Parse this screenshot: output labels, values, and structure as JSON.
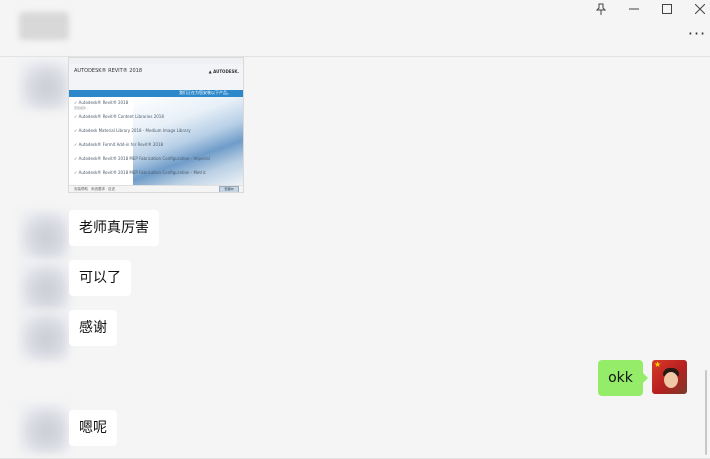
{
  "titlebar": {
    "icons": {
      "pin": "pin-icon",
      "minimize": "minimize-icon",
      "maximize": "maximize-icon",
      "close": "close-icon",
      "more": "more-icon"
    },
    "more_label": "···"
  },
  "image_message": {
    "brand": "AUTODESK® REVIT® 2018",
    "logo": "▲ AUTODESK.",
    "bar_text": "我们正在为您安装以下产品。",
    "rows": [
      {
        "title": "✓ Autodesk® Revit® 2018",
        "sub": "安装组件..."
      },
      {
        "title": "✓ Autodesk® Revit® Content Libraries 2018",
        "sub": ""
      },
      {
        "title": "✓ Autodesk Material Library 2018 - Medium Image Library",
        "sub": ""
      },
      {
        "title": "✓ Autodesk® Formit Add-in for Revit® 2018",
        "sub": ""
      },
      {
        "title": "✓ Autodesk® Revit® 2018 MEP Fabrication Configuration - Imperial",
        "sub": ""
      },
      {
        "title": "✓ Autodesk® Revit® 2018 MEP Fabrication Configuration - Metric",
        "sub": ""
      }
    ],
    "footer": [
      "安装帮助",
      "系统要求",
      "自述"
    ],
    "install_button": "安装中"
  },
  "messages": [
    {
      "sender": "other",
      "text": "老师真厉害"
    },
    {
      "sender": "other",
      "text": "可以了"
    },
    {
      "sender": "other",
      "text": "感谢"
    },
    {
      "sender": "self",
      "text": "okk"
    },
    {
      "sender": "other",
      "text": "嗯呢"
    }
  ],
  "colors": {
    "self_bubble": "#95ec69",
    "other_bubble": "#ffffff",
    "background": "#f5f5f5"
  }
}
